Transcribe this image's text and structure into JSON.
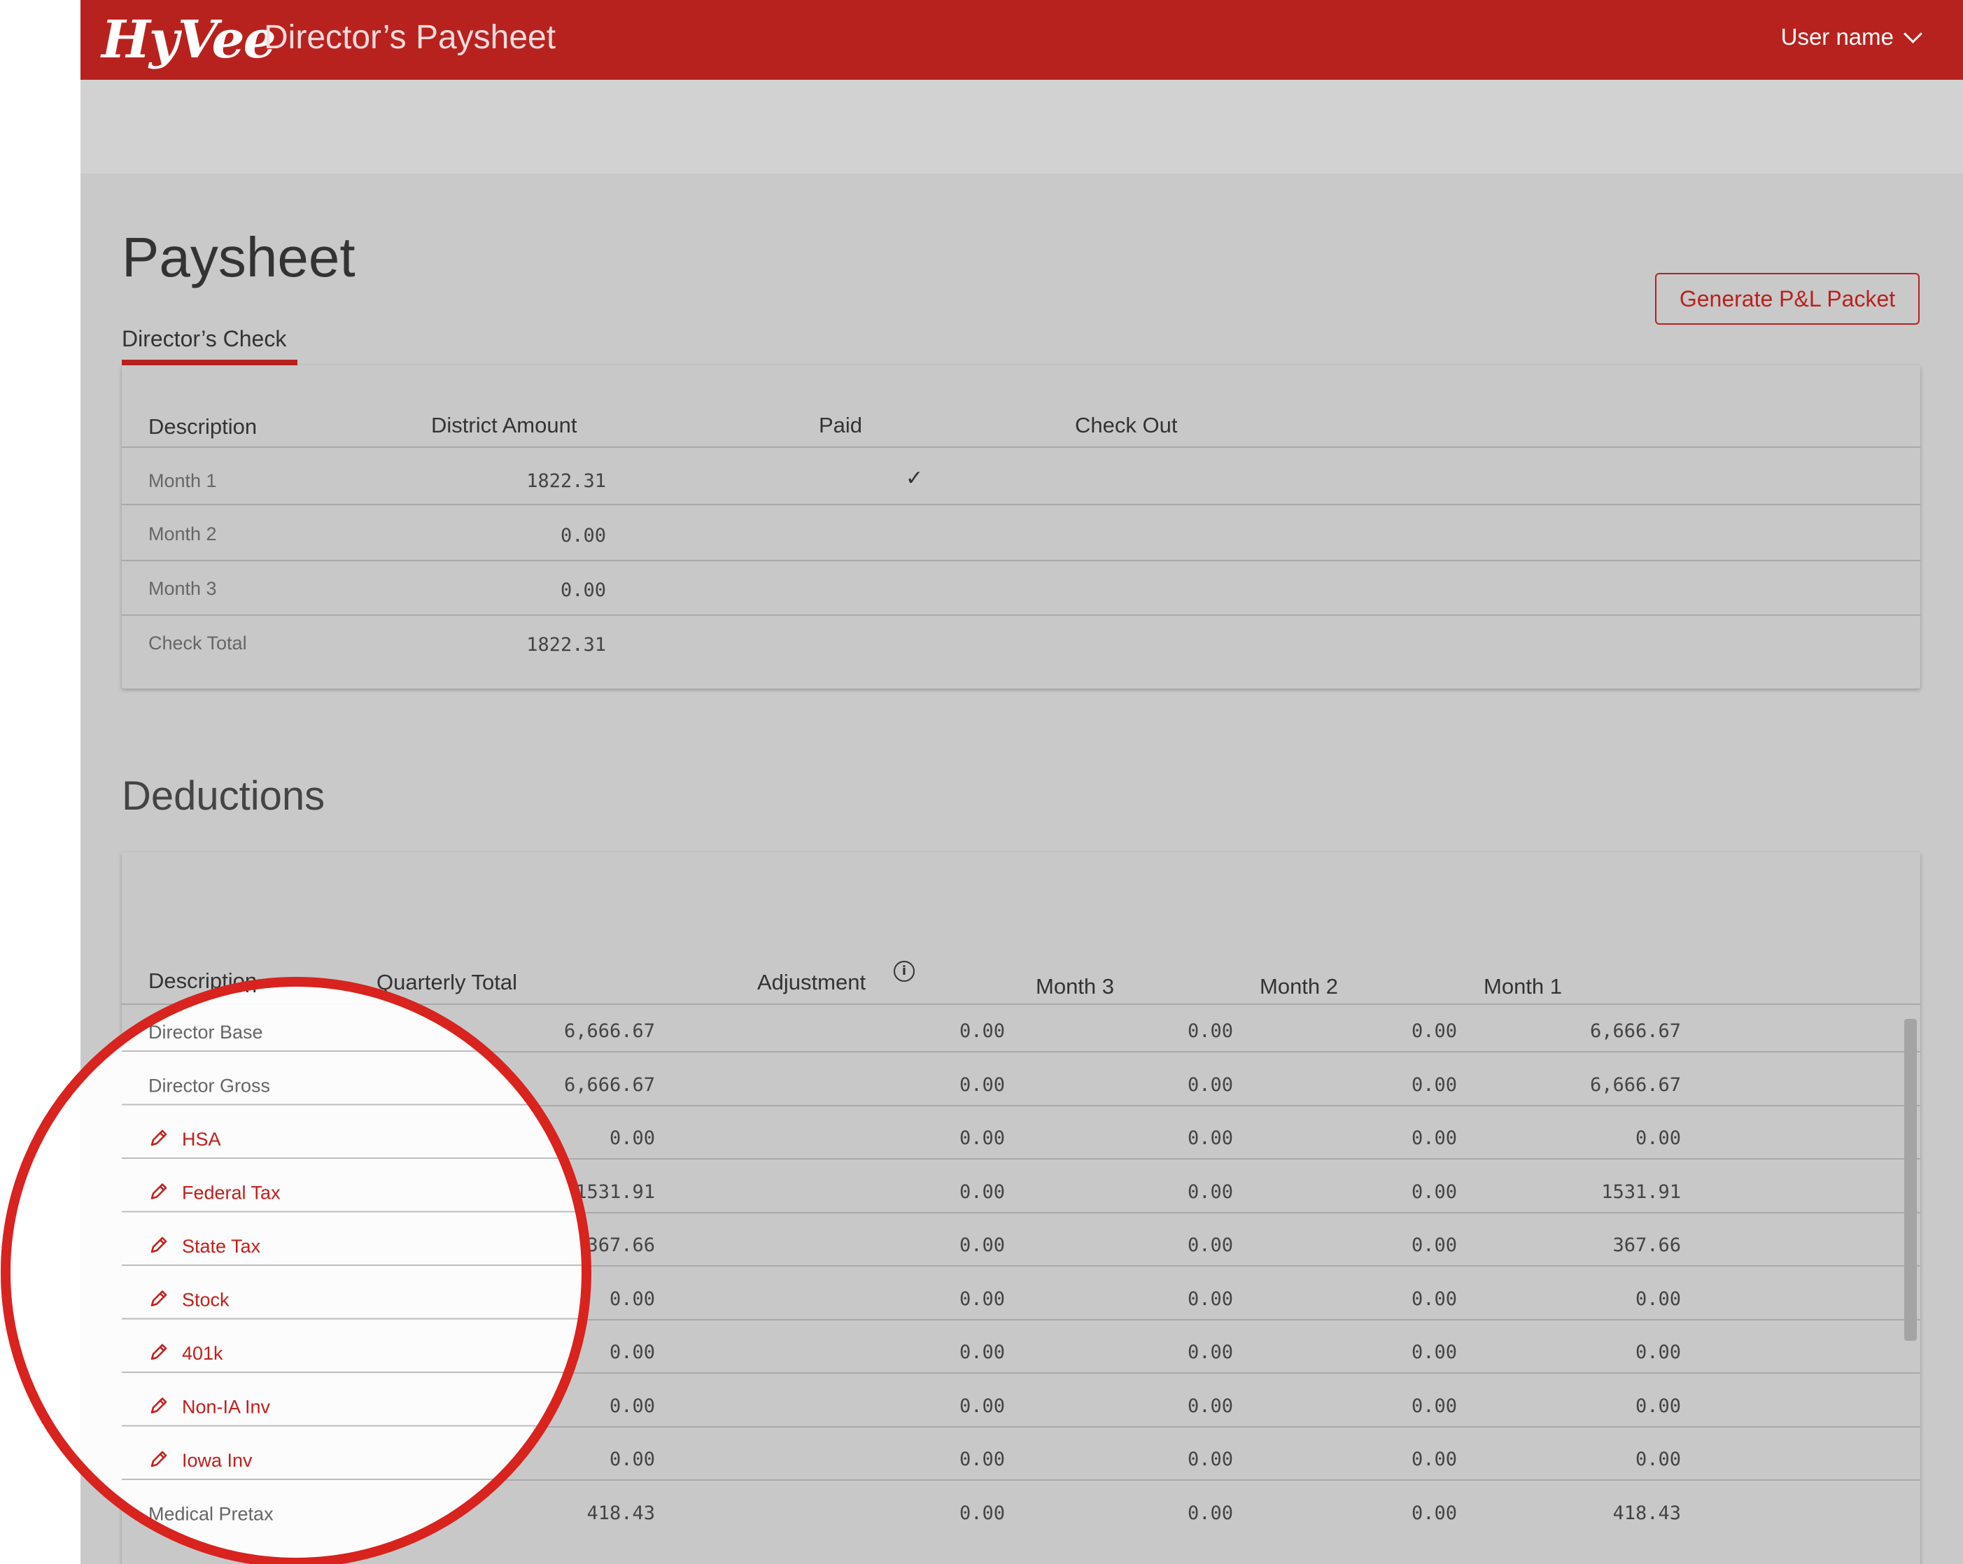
{
  "header": {
    "logo": "HyVee",
    "app_title": "Director’s Paysheet",
    "user_menu": "User name"
  },
  "page": {
    "title": "Paysheet",
    "tab": "Director’s Check",
    "generate_button": "Generate P&L Packet"
  },
  "check_table": {
    "headers": {
      "description": "Description",
      "district_amount": "District Amount",
      "paid": "Paid",
      "check_out": "Check Out"
    },
    "rows": [
      {
        "description": "Month 1",
        "amount": "1822.31",
        "paid": "✓"
      },
      {
        "description": "Month 2",
        "amount": "0.00",
        "paid": ""
      },
      {
        "description": "Month 3",
        "amount": "0.00",
        "paid": ""
      },
      {
        "description": "Check Total",
        "amount": "1822.31",
        "paid": ""
      }
    ]
  },
  "deductions": {
    "title": "Deductions",
    "headers": {
      "description": "Description",
      "quarterly_total": "Quarterly Total",
      "adjustment": "Adjustment",
      "month3": "Month 3",
      "month2": "Month 2",
      "month1": "Month 1"
    },
    "rows": [
      {
        "description": "Director Base",
        "editable": false,
        "quarterly": "6,666.67",
        "adjustment": "0.00",
        "m3": "0.00",
        "m2": "0.00",
        "m1": "6,666.67"
      },
      {
        "description": "Director Gross",
        "editable": false,
        "quarterly": "6,666.67",
        "adjustment": "0.00",
        "m3": "0.00",
        "m2": "0.00",
        "m1": "6,666.67"
      },
      {
        "description": "HSA",
        "editable": true,
        "quarterly": "0.00",
        "adjustment": "0.00",
        "m3": "0.00",
        "m2": "0.00",
        "m1": "0.00"
      },
      {
        "description": "Federal Tax",
        "editable": true,
        "quarterly": "1531.91",
        "adjustment": "0.00",
        "m3": "0.00",
        "m2": "0.00",
        "m1": "1531.91"
      },
      {
        "description": "State Tax",
        "editable": true,
        "quarterly": "367.66",
        "adjustment": "0.00",
        "m3": "0.00",
        "m2": "0.00",
        "m1": "367.66"
      },
      {
        "description": "Stock",
        "editable": true,
        "quarterly": "0.00",
        "adjustment": "0.00",
        "m3": "0.00",
        "m2": "0.00",
        "m1": "0.00"
      },
      {
        "description": "401k",
        "editable": true,
        "quarterly": "0.00",
        "adjustment": "0.00",
        "m3": "0.00",
        "m2": "0.00",
        "m1": "0.00"
      },
      {
        "description": "Non-IA Inv",
        "editable": true,
        "quarterly": "0.00",
        "adjustment": "0.00",
        "m3": "0.00",
        "m2": "0.00",
        "m1": "0.00"
      },
      {
        "description": "Iowa Inv",
        "editable": true,
        "quarterly": "0.00",
        "adjustment": "0.00",
        "m3": "0.00",
        "m2": "0.00",
        "m1": "0.00"
      },
      {
        "description": "Medical Pretax",
        "editable": false,
        "quarterly": "418.43",
        "adjustment": "0.00",
        "m3": "0.00",
        "m2": "0.00",
        "m1": "418.43"
      }
    ]
  },
  "colors": {
    "brand_red": "#b8221e",
    "highlight_red": "#d8231f"
  }
}
